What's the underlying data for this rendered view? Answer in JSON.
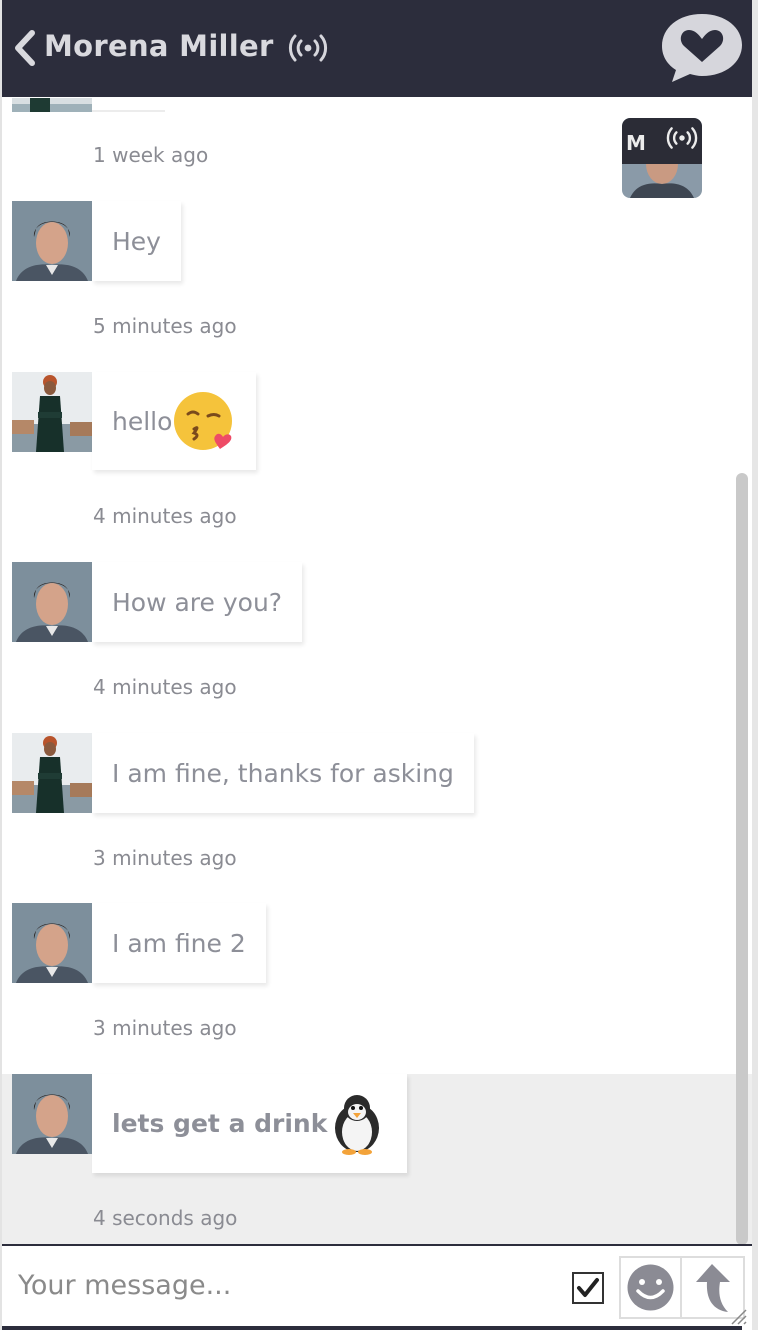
{
  "header": {
    "title": "Morena Miller",
    "back_icon": "chevron-left-icon",
    "live_icon": "broadcast-icon",
    "logo_icon": "chat-heart-icon",
    "bg_color": "#2c2d3c"
  },
  "current_user": {
    "initial": "M"
  },
  "messages": [
    {
      "sender": "man",
      "text": "Hey",
      "time": "5 minutes ago",
      "emoji": ""
    },
    {
      "sender": "woman",
      "text": "hello",
      "time": "4 minutes ago",
      "emoji": "kissing-face-emoji"
    },
    {
      "sender": "man",
      "text": "How are you?",
      "time": "4 minutes ago",
      "emoji": ""
    },
    {
      "sender": "woman",
      "text": "I am fine, thanks for asking",
      "time": "3 minutes ago",
      "emoji": ""
    },
    {
      "sender": "man",
      "text": "I am fine 2",
      "time": "3 minutes ago",
      "emoji": ""
    },
    {
      "sender": "man",
      "text": "lets get a drink",
      "time": "4 seconds ago",
      "emoji": "penguin-emoji",
      "bold": true
    }
  ],
  "earlier": {
    "time": "1 week ago"
  },
  "composer": {
    "placeholder": "Your message...",
    "checkbox_checked": true,
    "emoji_button_icon": "smiley-icon",
    "send_button_icon": "send-arrow-icon"
  }
}
